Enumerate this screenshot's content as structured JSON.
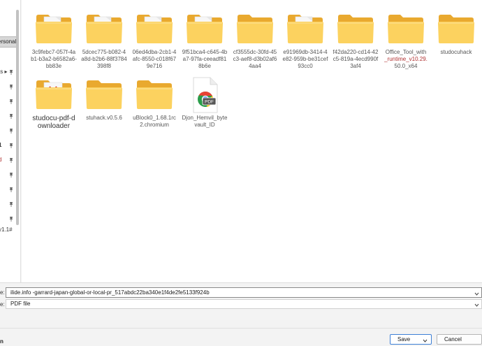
{
  "left_pane": {
    "personal_label": "ersonal",
    "rows": [
      {
        "label": "ts ▸",
        "pinned": true
      },
      {
        "label": "",
        "pinned": true
      },
      {
        "label": "",
        "pinned": true
      },
      {
        "label": "",
        "pinned": true
      },
      {
        "label": "",
        "pinned": true
      },
      {
        "label": "1",
        "pinned": true
      },
      {
        "label": "d",
        "pinned": true
      },
      {
        "label": "",
        "pinned": true
      },
      {
        "label": "",
        "pinned": true
      },
      {
        "label": "",
        "pinned": true
      },
      {
        "label": "",
        "pinned": true
      },
      {
        "label": "y1.1#",
        "pinned": false
      }
    ]
  },
  "files": [
    {
      "name": "3c9febc7-057f-4ab1-b3a2-b6582a6-bb83e",
      "kind": "folder-doc",
      "highlight": ""
    },
    {
      "name": "5dcec775-b082-4a8d-b2b6-88f3784398f8",
      "kind": "folder-doc",
      "highlight": ""
    },
    {
      "name": "06ed4dba-2cb1-4afc-8550-c018f679e716",
      "kind": "folder-doc",
      "highlight": ""
    },
    {
      "name": "9f51bca4-c645-4ba7-97fa-ceeadf818b6e",
      "kind": "folder-doc",
      "highlight": ""
    },
    {
      "name": "cf3555dc-30fd-45c3-aef8-d3b02af64aa4",
      "kind": "folder",
      "highlight": ""
    },
    {
      "name": "e91969db-3414-4e82-959b-be31cef93cc0",
      "kind": "folder-doc",
      "highlight": ""
    },
    {
      "name": "f42da220-cd14-42c5-819a-4ecd990f3af4",
      "kind": "folder",
      "highlight": ""
    },
    {
      "name": "Office_Tool_with",
      "name2": "_runtime_v10.29.",
      "name3": "50.0_x64",
      "kind": "folder",
      "highlight": "_runtime_v10.29."
    },
    {
      "name": "studocuhack",
      "kind": "folder",
      "highlight": ""
    },
    {
      "name": "studocu-pdf-downloader",
      "kind": "folder-pdf",
      "highlight": ""
    },
    {
      "name": "stuhack.v0.5.6",
      "kind": "folder",
      "highlight": ""
    },
    {
      "name": "uBlock0_1.68.1rc2.chromium",
      "kind": "folder",
      "highlight": ""
    },
    {
      "name": "Djon_Hemvil_bytevault_ID",
      "kind": "pdf-file",
      "highlight": ""
    }
  ],
  "bottom": {
    "filename_label": "e:",
    "filename_value": "ilide.info -garrard-japan-global-or-local-pr_517abdc22ba340e1f4de2fe5133f924b",
    "filetype_label": "e:",
    "filetype_value": "PDF file",
    "hide_label": "n",
    "save_label": "Save",
    "cancel_label": "Cancel"
  },
  "colors": {
    "folder_back": "#e9a92f",
    "folder_front": "#fcd25f",
    "accent_blue": "#3d7fd6",
    "highlight_red": "#b03030"
  }
}
